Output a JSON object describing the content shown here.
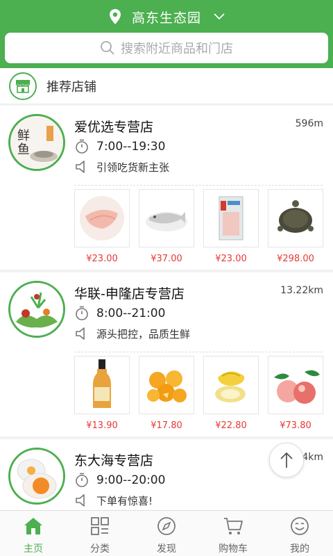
{
  "header": {
    "location": "高东生态园",
    "search_placeholder": "搜索附近商品和门店"
  },
  "section": {
    "title": "推荐店铺"
  },
  "stores": [
    {
      "name": "爱优选专营店",
      "distance": "596m",
      "hours": "7:00--19:30",
      "slogan": "引领吃货新主张",
      "products": [
        {
          "price": "¥23.00"
        },
        {
          "price": "¥37.00"
        },
        {
          "price": "¥23.00"
        },
        {
          "price": "¥298.00"
        }
      ]
    },
    {
      "name": "华联-申隆店专营店",
      "distance": "13.22km",
      "hours": "8:00--21:00",
      "slogan": "源头把控，品质生鲜",
      "products": [
        {
          "price": "¥13.90"
        },
        {
          "price": "¥17.80"
        },
        {
          "price": "¥22.80"
        },
        {
          "price": "¥73.80"
        }
      ]
    },
    {
      "name": "东大海专营店",
      "distance": "4km",
      "hours": "9:00--20:00",
      "slogan": "下单有惊喜!"
    }
  ],
  "tabs": [
    {
      "label": "主页",
      "icon": "home-icon",
      "active": true
    },
    {
      "label": "分类",
      "icon": "category-icon"
    },
    {
      "label": "发现",
      "icon": "compass-icon"
    },
    {
      "label": "购物车",
      "icon": "cart-icon"
    },
    {
      "label": "我的",
      "icon": "profile-icon"
    }
  ],
  "colors": {
    "brand": "#4caf50",
    "price": "#e53935"
  }
}
